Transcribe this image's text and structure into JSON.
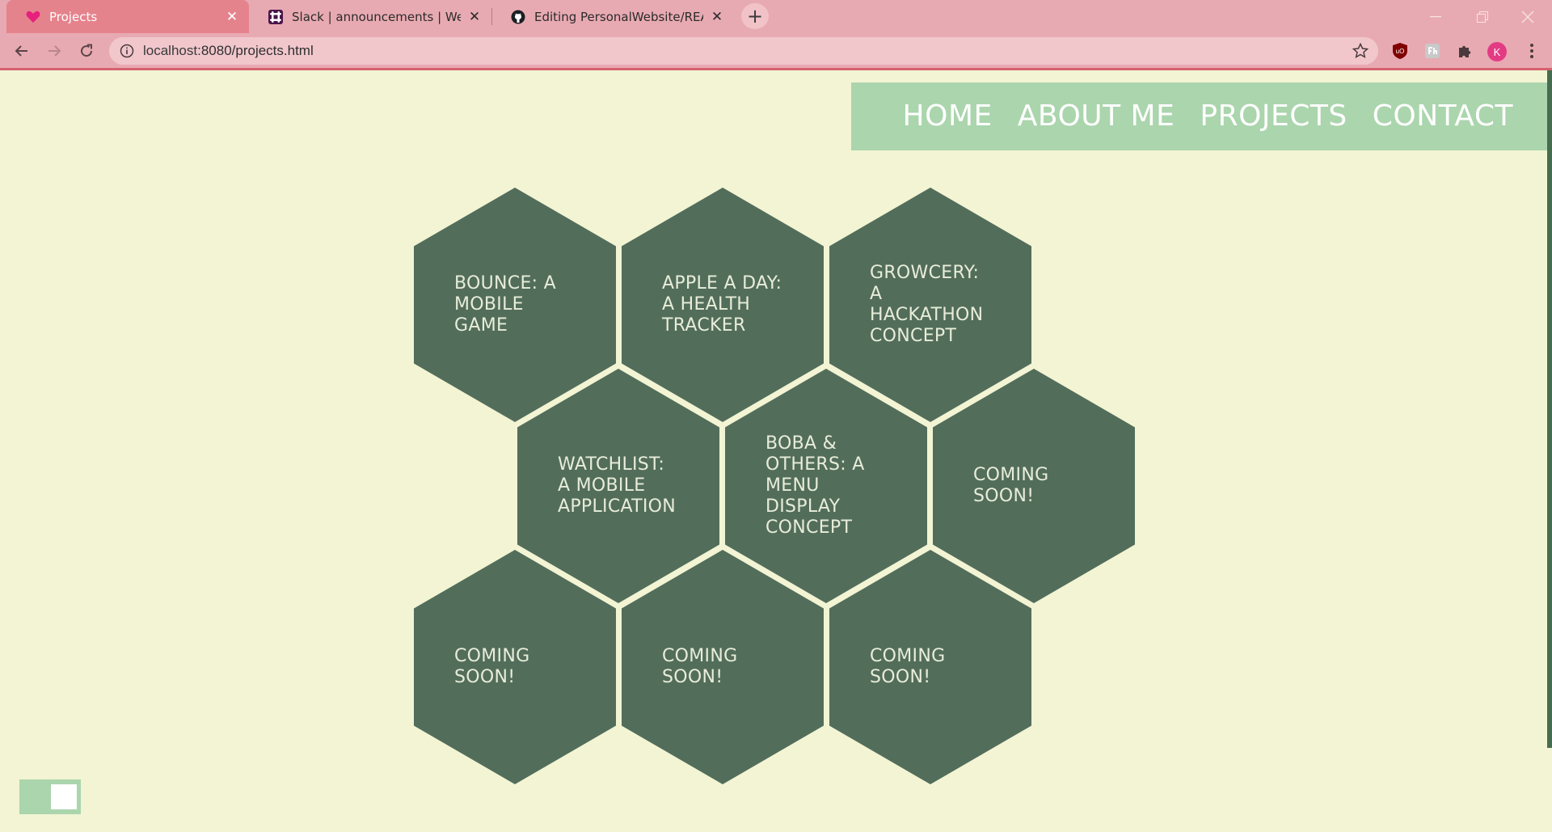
{
  "browser": {
    "tabs": [
      {
        "title": "Projects",
        "favicon": "heart-icon",
        "active": true
      },
      {
        "title": "Slack | announcements | Web De",
        "favicon": "slack-icon",
        "active": false
      },
      {
        "title": "Editing PersonalWebsite/READM",
        "favicon": "github-icon",
        "active": false
      }
    ],
    "new_tab": "+",
    "url_host": "localhost",
    "url_rest": ":8080/projects.html",
    "avatar_letter": "K",
    "colors": {
      "chrome": "#e8aab2",
      "active_tab": "#e5838d",
      "avatar": "#e33b83"
    }
  },
  "nav": {
    "items": [
      {
        "label": "HOME"
      },
      {
        "label": "ABOUT ME"
      },
      {
        "label": "PROJECTS"
      },
      {
        "label": "CONTACT"
      }
    ]
  },
  "projects": [
    {
      "label": "BOUNCE: A MOBILE GAME"
    },
    {
      "label": "APPLE A DAY: A HEALTH TRACKER"
    },
    {
      "label": "GROWCERY: A HACKATHON CONCEPT"
    },
    {
      "label": "WATCHLIST: A MOBILE APPLICATION"
    },
    {
      "label": "BOBA & OTHERS: A MENU DISPLAY CONCEPT"
    },
    {
      "label": "COMING SOON!"
    },
    {
      "label": "COMING SOON!"
    },
    {
      "label": "COMING SOON!"
    },
    {
      "label": "COMING SOON!"
    }
  ],
  "theme": {
    "page_bg": "#f2f4d3",
    "nav_bg": "#abd5ad",
    "hex_bg": "#536d5b"
  },
  "toggle": {
    "state": "on"
  }
}
